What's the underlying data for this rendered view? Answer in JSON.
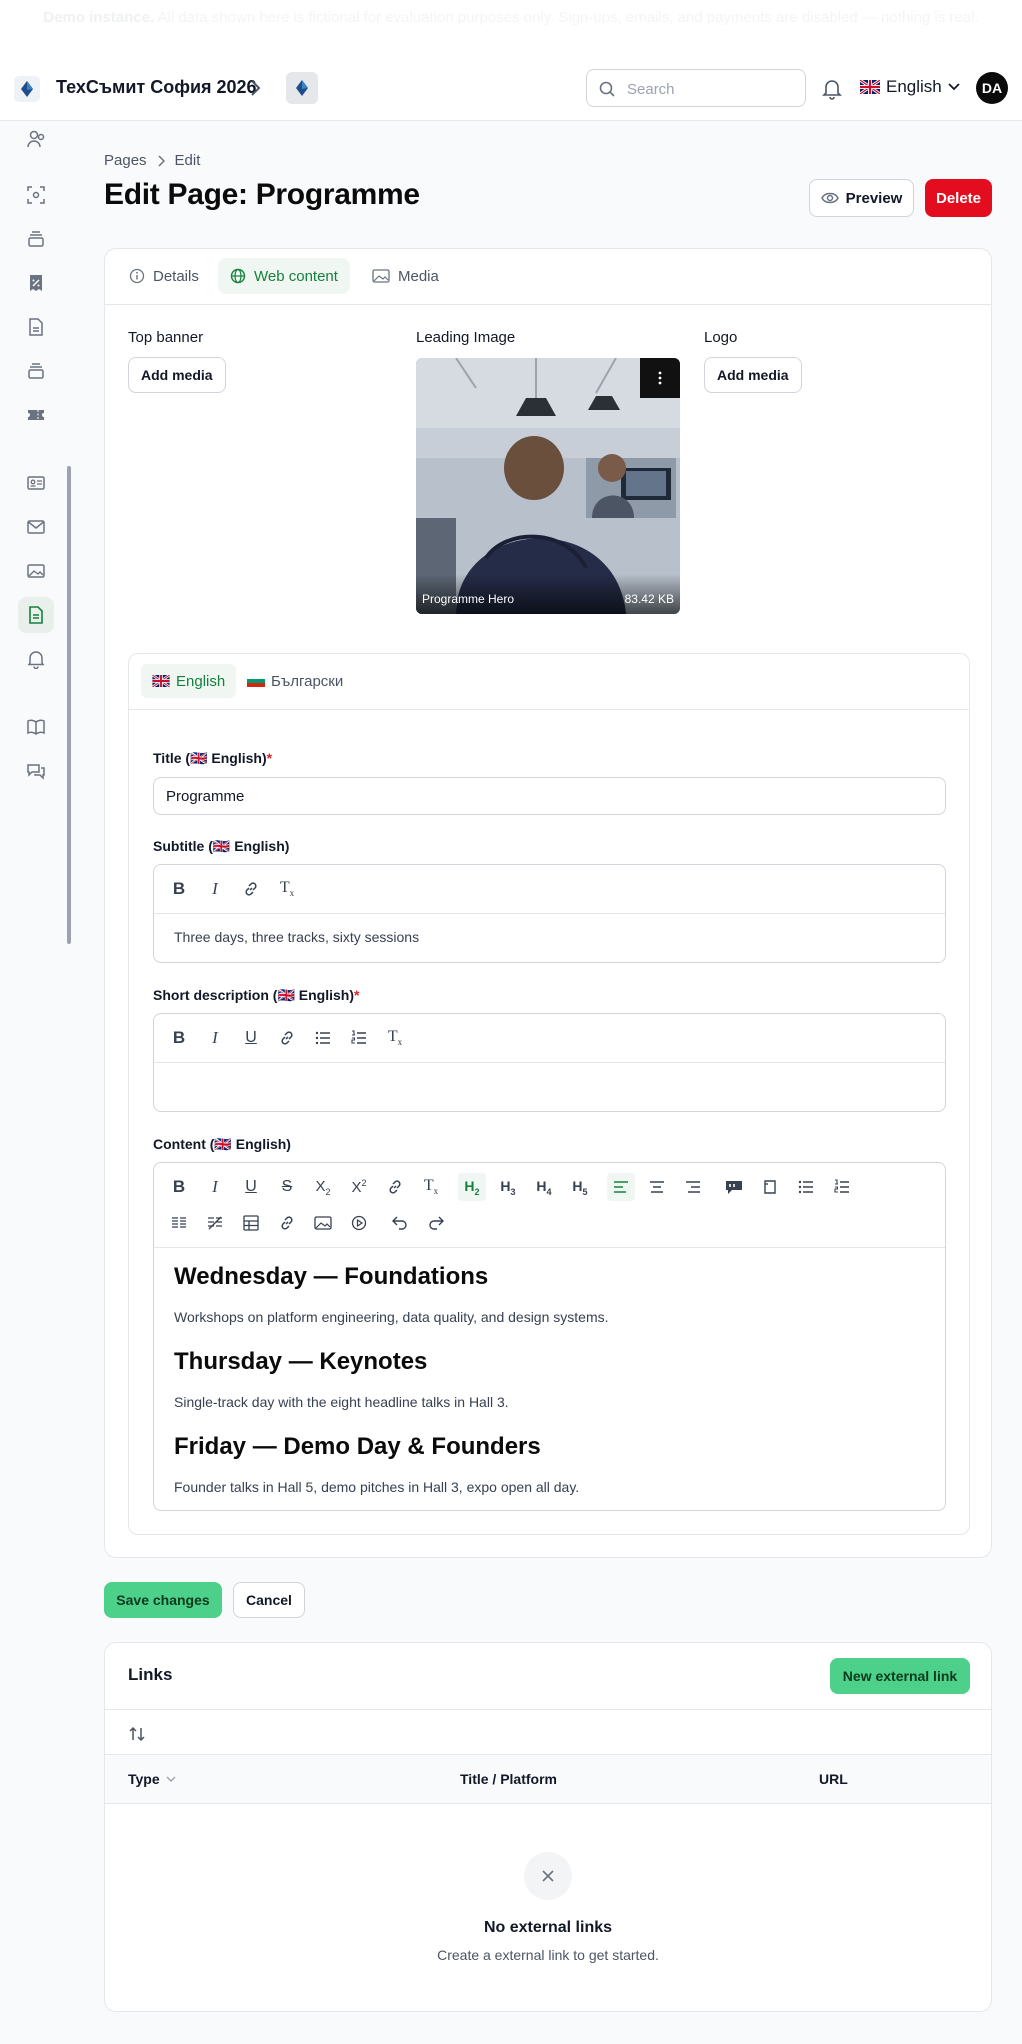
{
  "banner": {
    "bold": "Demo instance.",
    "text": "All data shown here is fictional for evaluation purposes only. Sign-ups, emails, and payments are disabled — nothing is real."
  },
  "header": {
    "event_name": "ТехСъмит София 2026",
    "search_placeholder": "Search",
    "language": "English",
    "avatar_initials": "DA"
  },
  "breadcrumbs": [
    "Pages",
    "Edit"
  ],
  "page": {
    "title": "Edit Page: Programme"
  },
  "actions": {
    "preview": "Preview",
    "delete": "Delete"
  },
  "tabs": [
    "Details",
    "Web content",
    "Media"
  ],
  "media": {
    "top_banner_label": "Top banner",
    "leading_image_label": "Leading Image",
    "logo_label": "Logo",
    "add_media": "Add media",
    "image_name": "Programme Hero",
    "image_size": "83.42 KB"
  },
  "locale_tabs": [
    "English",
    "Български"
  ],
  "form": {
    "title_label": "Title (🇬🇧 English)",
    "title_value": "Programme",
    "subtitle_label": "Subtitle (🇬🇧 English)",
    "subtitle_value": "Three days, three tracks, sixty sessions",
    "short_desc_label": "Short description (🇬🇧 English)",
    "content_label": "Content (🇬🇧 English)",
    "required_mark": "*"
  },
  "content": [
    {
      "heading": "Wednesday — Foundations",
      "text": "Workshops on platform engineering, data quality, and design systems."
    },
    {
      "heading": "Thursday — Keynotes",
      "text": "Single-track day with the eight headline talks in Hall 3."
    },
    {
      "heading": "Friday — Demo Day & Founders",
      "text": "Founder talks in Hall 5, demo pitches in Hall 3, expo open all day."
    }
  ],
  "form_actions": {
    "save": "Save changes",
    "cancel": "Cancel"
  },
  "links": {
    "title": "Links",
    "new_button": "New external link",
    "columns": [
      "Type",
      "Title / Platform",
      "URL"
    ],
    "empty_title": "No external links",
    "empty_subtitle": "Create a external link to get started."
  },
  "colors": {
    "accent_green": "#15803d",
    "primary_button": "#4cd08a",
    "danger": "#e30d1f"
  }
}
